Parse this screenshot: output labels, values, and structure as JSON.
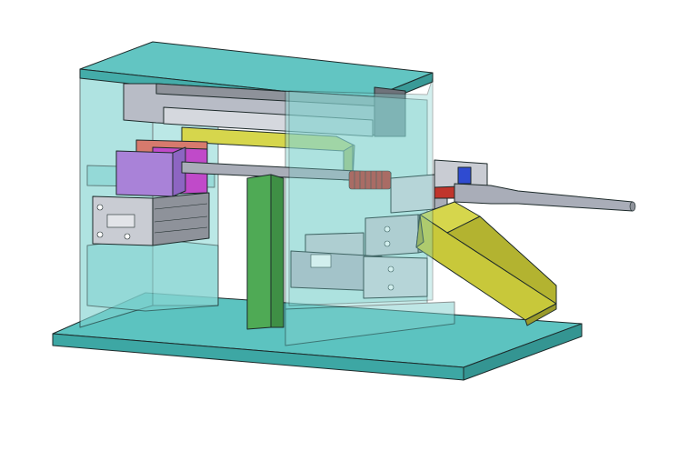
{
  "scene": {
    "background": "#ffffff",
    "colors": {
      "glass_panel": "#7fd2cf",
      "top_plate": "#62c5c2",
      "base_plate": "#5cc3c0",
      "cylinder_gray": "#c9ccd3",
      "cylinder_dark": "#8e929a",
      "slide_magenta": "#c04ac9",
      "slide_purple": "#a982d8",
      "slide_salmon": "#d77a6d",
      "pillar_green": "#4faa55",
      "chute_yellow": "#c8c83a",
      "bracket_yellow": "#d6d64c",
      "spring_red": "#c0352c",
      "clamp_blue": "#2f4bd1",
      "shaft_gray": "#a9adb8"
    },
    "parts": [
      "base-plate",
      "frame-top-plate",
      "left-glass-panel",
      "center-glass-panel",
      "rodless-cylinder",
      "guide-rod",
      "vertical-pillar",
      "compact-cylinder-left",
      "compact-cylinder-right",
      "spring",
      "gripper",
      "chute",
      "nozzle-shaft"
    ]
  }
}
